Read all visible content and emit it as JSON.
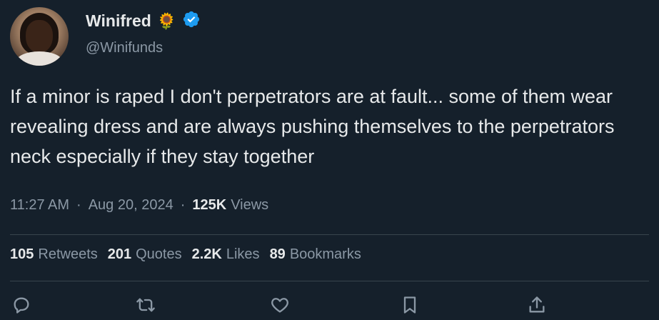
{
  "author": {
    "display_name": "Winifred",
    "emoji": "🌻",
    "handle": "@Winifunds",
    "verified_badge_color": "#1d9bf0"
  },
  "tweet": {
    "text": "If a minor is raped I don't perpetrators are at fault... some of them wear revealing dress and are always pushing themselves to the perpetrators neck especially if they stay together",
    "time": "11:27 AM",
    "date": "Aug 20, 2024",
    "views_count": "125K",
    "views_label": "Views"
  },
  "stats": {
    "retweets_count": "105",
    "retweets_label": "Retweets",
    "quotes_count": "201",
    "quotes_label": "Quotes",
    "likes_count": "2.2K",
    "likes_label": "Likes",
    "bookmarks_count": "89",
    "bookmarks_label": "Bookmarks"
  },
  "actions": [
    "reply-icon",
    "retweet-icon",
    "like-icon",
    "bookmark-icon",
    "share-icon"
  ],
  "colors": {
    "background": "#15202b",
    "text": "#e7e9ea",
    "muted": "#8b98a5",
    "divider": "#38444d"
  }
}
